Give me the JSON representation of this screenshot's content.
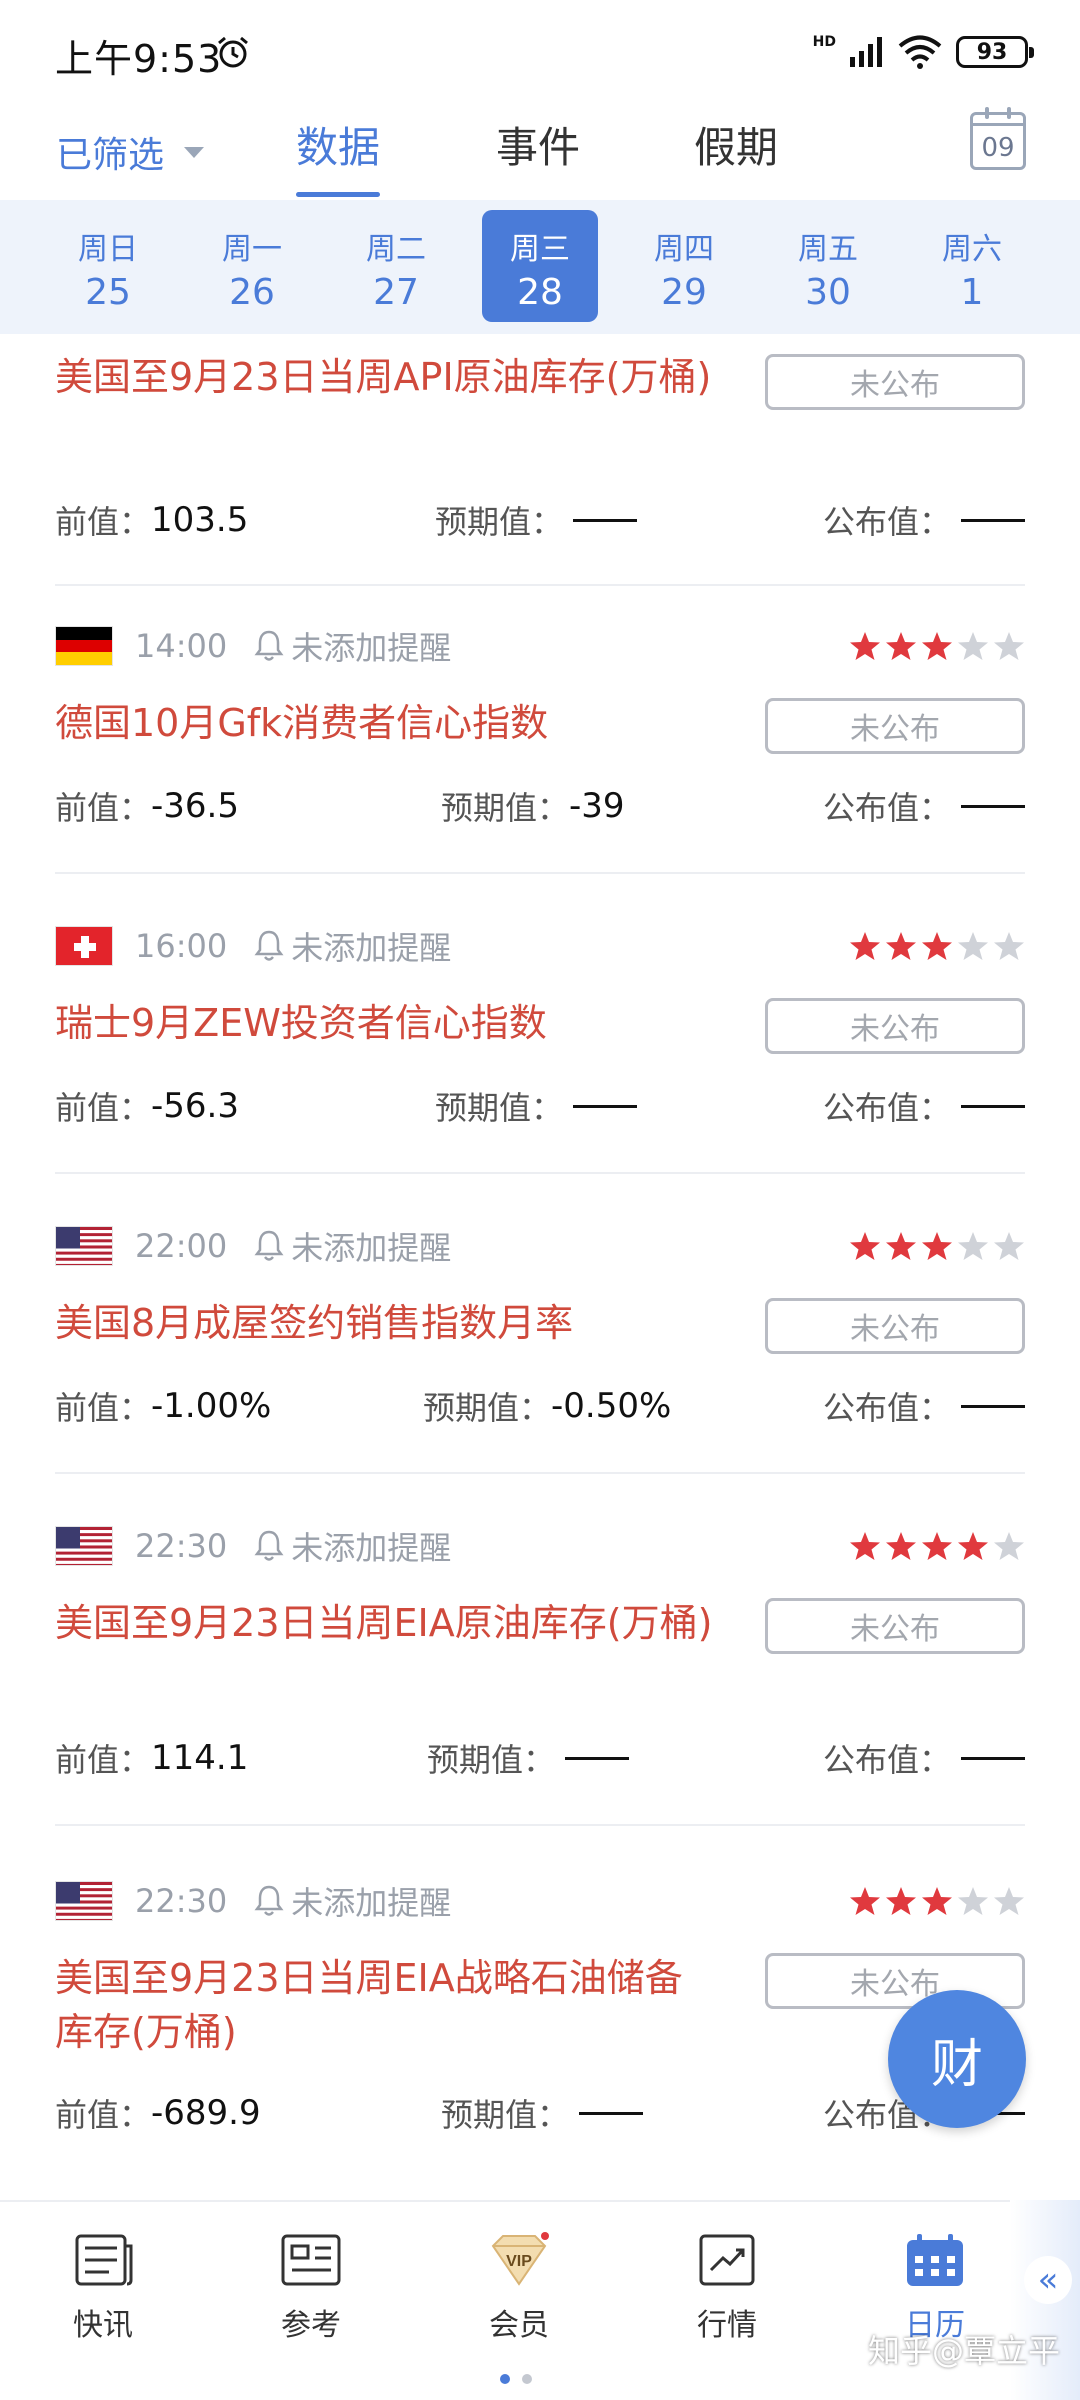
{
  "status_bar": {
    "time": "上午9:53",
    "network": "HD",
    "battery": "93"
  },
  "top_nav": {
    "filter_label": "已筛选",
    "tabs": [
      {
        "label": "数据",
        "active": true
      },
      {
        "label": "事件",
        "active": false
      },
      {
        "label": "假期",
        "active": false
      }
    ],
    "calendar_day": "09"
  },
  "week": [
    {
      "dow": "周日",
      "num": "25"
    },
    {
      "dow": "周一",
      "num": "26"
    },
    {
      "dow": "周二",
      "num": "27"
    },
    {
      "dow": "周三",
      "num": "28",
      "active": true
    },
    {
      "dow": "周四",
      "num": "29"
    },
    {
      "dow": "周五",
      "num": "30"
    },
    {
      "dow": "周六",
      "num": "1"
    }
  ],
  "labels": {
    "prev": "前值：",
    "expected": "预期值：",
    "actual": "公布值：",
    "status": "未公布",
    "remind": "未添加提醒"
  },
  "events": [
    {
      "title": "美国至9月23日当周API原油库存(万桶)",
      "prev": "103.5",
      "expected": "",
      "actual": ""
    },
    {
      "country": "germany",
      "time": "14:00",
      "stars": 3,
      "title": "德国10月Gfk消费者信心指数",
      "prev": "-36.5",
      "expected": "-39",
      "actual": ""
    },
    {
      "country": "switzerland",
      "time": "16:00",
      "stars": 3,
      "title": "瑞士9月ZEW投资者信心指数",
      "prev": "-56.3",
      "expected": "",
      "actual": ""
    },
    {
      "country": "usa",
      "time": "22:00",
      "stars": 3,
      "title": "美国8月成屋签约销售指数月率",
      "prev": "-1.00%",
      "expected": "-0.50%",
      "actual": ""
    },
    {
      "country": "usa",
      "time": "22:30",
      "stars": 4,
      "title": "美国至9月23日当周EIA原油库存(万桶)",
      "prev": "114.1",
      "expected": "",
      "actual": ""
    },
    {
      "country": "usa",
      "time": "22:30",
      "stars": 3,
      "title": "美国至9月23日当周EIA战略石油储备库存(万桶)",
      "prev": "-689.9",
      "expected": "",
      "actual": ""
    }
  ],
  "fab": {
    "label": "财"
  },
  "bottom_nav": [
    {
      "label": "快讯",
      "icon": "news-icon"
    },
    {
      "label": "参考",
      "icon": "reference-icon"
    },
    {
      "label": "会员",
      "icon": "vip-icon"
    },
    {
      "label": "行情",
      "icon": "market-icon"
    },
    {
      "label": "日历",
      "icon": "calendar-icon",
      "active": true
    }
  ],
  "watermark": "知乎@覃立平",
  "colors": {
    "accent": "#4a7bd8",
    "title_red": "#d04a3c",
    "star_red": "#e0393e",
    "star_grey": "#cfd2d8"
  }
}
